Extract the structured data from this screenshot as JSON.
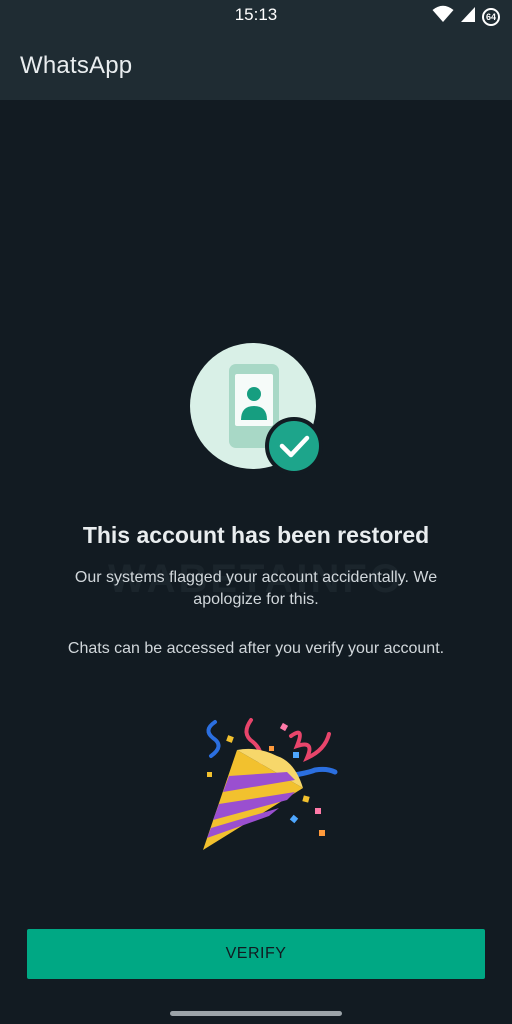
{
  "status_bar": {
    "time": "15:13",
    "battery_level": "64",
    "icons": [
      "wifi-icon",
      "signal-icon",
      "battery-icon"
    ]
  },
  "app_bar": {
    "title": "WhatsApp"
  },
  "main": {
    "illustration_icon": "phone-verified-icon",
    "headline": "This account has been restored",
    "watermark": "WABETAINFO",
    "body": "Our systems flagged your account accidentally. We apologize for this.",
    "verify_note": "Chats can be accessed after you verify your account.",
    "celebration_icon": "party-popper-icon"
  },
  "actions": {
    "verify_label": "VERIFY"
  },
  "colors": {
    "background": "#121b22",
    "app_bar": "#1f2c33",
    "accent": "#00a884",
    "illustration_circle": "#d9f0e7",
    "check_badge": "#1da58b"
  }
}
